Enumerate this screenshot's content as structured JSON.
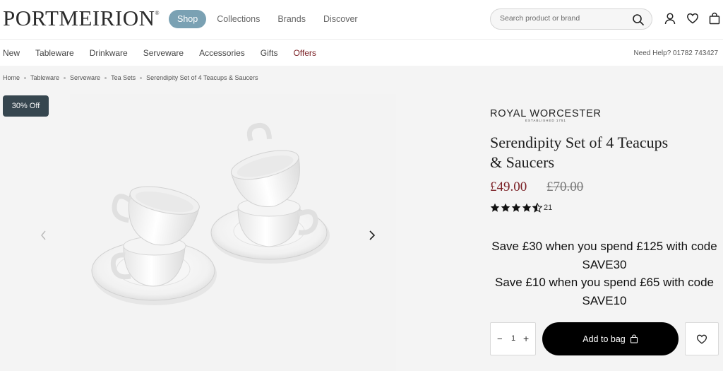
{
  "header": {
    "logo": "PORTMEIRION",
    "nav": [
      {
        "label": "Shop",
        "active": true
      },
      {
        "label": "Collections",
        "active": false
      },
      {
        "label": "Brands",
        "active": false
      },
      {
        "label": "Discover",
        "active": false
      }
    ],
    "search_placeholder": "Search product or brand",
    "icons": [
      "search-icon",
      "account-icon",
      "wishlist-heart-icon",
      "bag-icon"
    ]
  },
  "subnav": {
    "links": [
      "New",
      "Tableware",
      "Drinkware",
      "Serveware",
      "Accessories",
      "Gifts",
      "Offers"
    ],
    "help": "Need Help? 01782 743427"
  },
  "breadcrumb": [
    "Home",
    "Tableware",
    "Serveware",
    "Tea Sets",
    "Serendipity Set of 4 Teacups & Saucers"
  ],
  "badge": "30% Off",
  "product": {
    "brand": "ROYAL WORCESTER",
    "brand_tagline": "ESTABLISHED 1751",
    "title": "Serendipity Set of 4 Teacups & Saucers",
    "price": "£49.00",
    "was_price": "£70.00",
    "rating": 4.5,
    "review_count": "21",
    "promo": [
      "Save £30 when you spend £125 with code SAVE30",
      "Save £10 when you spend £65 with code SAVE10"
    ]
  },
  "purchase": {
    "minus": "−",
    "quantity": "1",
    "plus": "+",
    "add_to_bag": "Add to bag"
  },
  "colors": {
    "accent": "#7aa1b3",
    "sale": "#7a1f24",
    "badge": "#36464f"
  }
}
